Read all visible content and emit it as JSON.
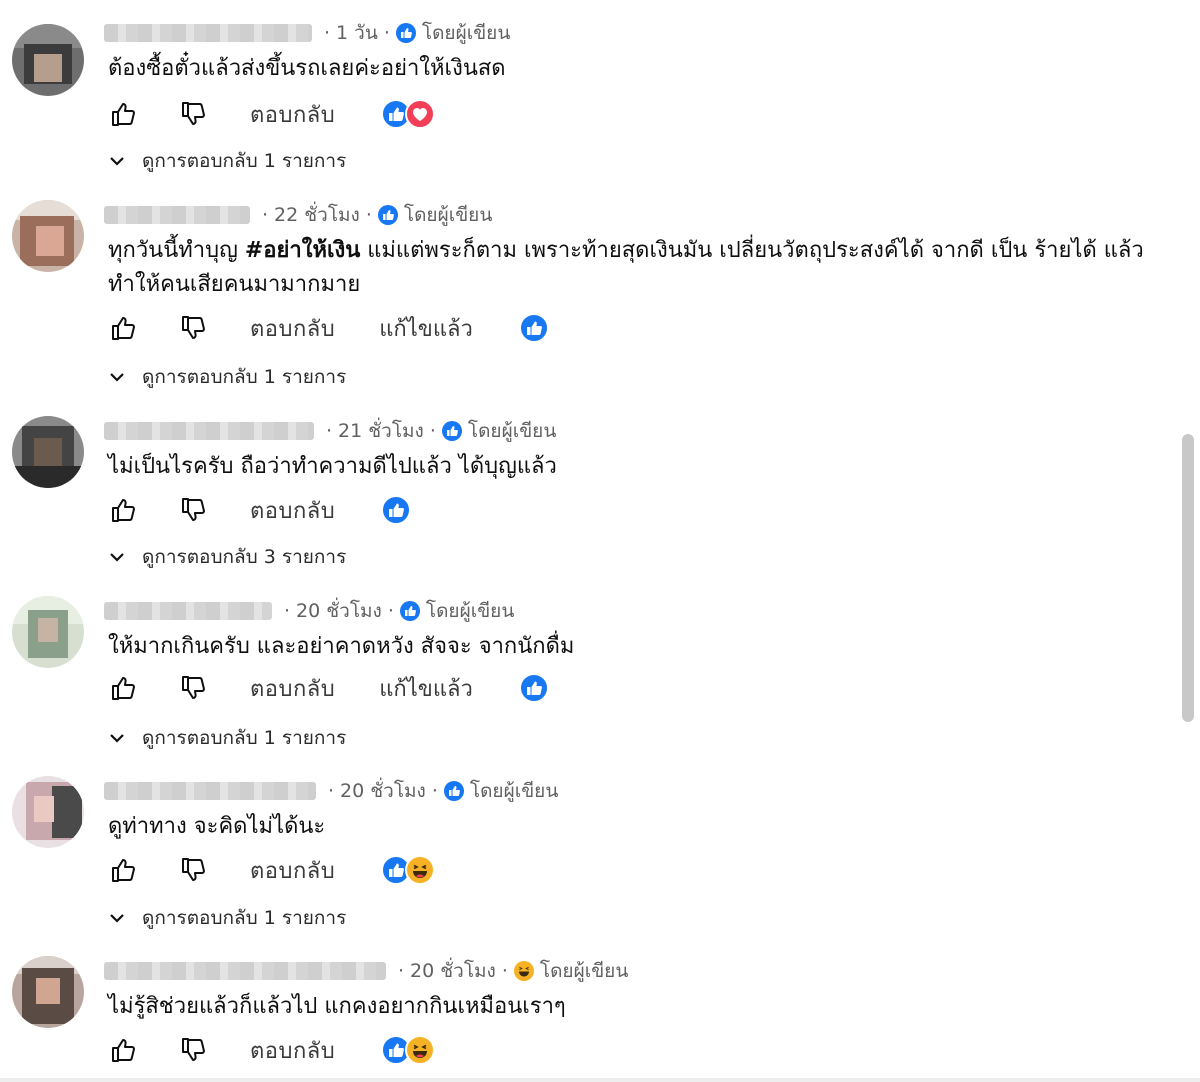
{
  "colors": {
    "text": "#0f0f0f",
    "meta": "#606060",
    "like_blue": "#1877f2",
    "love_red": "#f33e58",
    "haha_yellow": "#f7b125"
  },
  "labels": {
    "reply": "ตอบกลับ",
    "author_badge": "โดยผู้เขียน",
    "edited": "แก้ไขแล้ว"
  },
  "comments": [
    {
      "time": "1 วัน",
      "text": "ต้องซื้อตั๋วแล้วส่งขึ้นรถเลยค่ะอย่าให้เงินสด",
      "replies": "ดูการตอบกลับ 1 รายการ",
      "reactions": [
        "like",
        "love"
      ],
      "badge_icon": "like-icon"
    },
    {
      "time": "22 ชั่วโมง",
      "text_parts": [
        "ทุกวันนี้ทำบุญ ",
        "#อย่าให้เงิน",
        " แม่แต่พระก็ตาม เพราะท้ายสุดเงินมัน เปลี่ยนวัตถุประสงค์ได้ จากดี เป็น ร้ายได้ แล้วทำให้คนเสียคนมามากมาย"
      ],
      "replies": "ดูการตอบกลับ 1 รายการ",
      "edited": true,
      "reactions": [
        "like"
      ],
      "badge_icon": "like-icon"
    },
    {
      "time": "21 ชั่วโมง",
      "text": "ไม่เป็นไรครับ ถือว่าทำความดีไปแล้ว ได้บุญแล้ว",
      "replies": "ดูการตอบกลับ 3 รายการ",
      "reactions": [
        "like"
      ],
      "badge_icon": "like-icon"
    },
    {
      "time": "20 ชั่วโมง",
      "text": "ให้มากเกินครับ และอย่าคาดหวัง สัจจะ จากนักดื่ม",
      "replies": "ดูการตอบกลับ 1 รายการ",
      "edited": true,
      "reactions": [
        "like"
      ],
      "badge_icon": "like-icon"
    },
    {
      "time": "20 ชั่วโมง",
      "text": "ดูท่าทาง จะคิดไม่ได้นะ",
      "replies": "ดูการตอบกลับ 1 รายการ",
      "reactions": [
        "like",
        "haha"
      ],
      "badge_icon": "like-icon"
    },
    {
      "time": "20 ชั่วโมง",
      "text": "ไม่รู้สิช่วยแล้วก็แล้วไป แกคงอยากกินเหมือนเราๆ",
      "reactions": [
        "like",
        "haha"
      ],
      "badge_icon": "haha-icon"
    }
  ]
}
